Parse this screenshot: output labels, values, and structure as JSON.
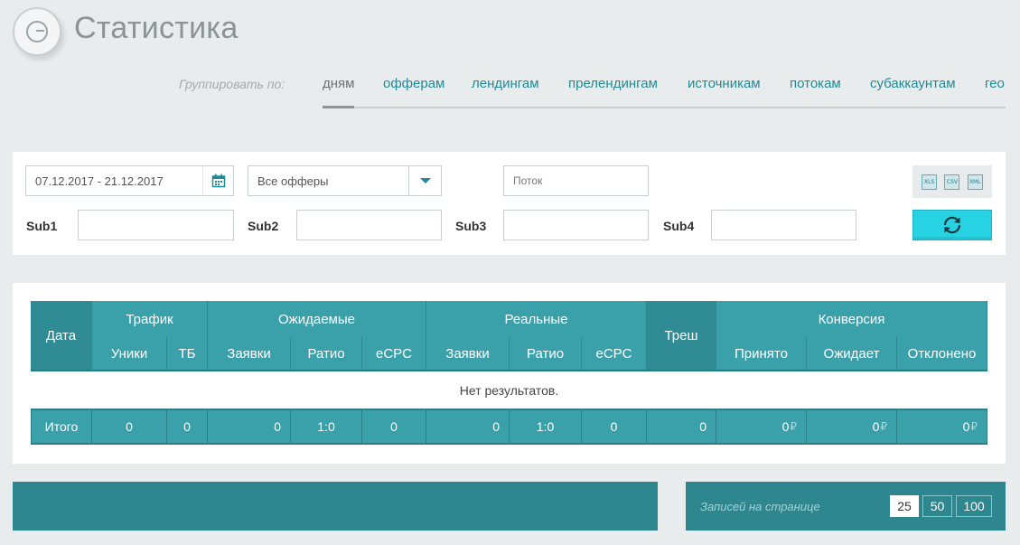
{
  "header": {
    "title": "Статистика"
  },
  "grouping": {
    "label": "Группировать по:",
    "tabs": [
      "дням",
      "офферам",
      "лендингам",
      "прелендингам",
      "источникам",
      "потокам",
      "субаккаунтам",
      "гео"
    ],
    "active": "дням"
  },
  "filters": {
    "date_range": "07.12.2017 - 21.12.2017",
    "offer_select": "Все офферы",
    "stream_placeholder": "Поток",
    "sub_labels": [
      "Sub1",
      "Sub2",
      "Sub3",
      "Sub4"
    ],
    "export_formats": [
      "XLS",
      "CSV",
      "XML"
    ]
  },
  "table": {
    "group_headers": [
      "Дата",
      "Трафик",
      "Ожидаемые",
      "Реальные",
      "Треш",
      "Конверсия"
    ],
    "sub_headers": [
      "Уники",
      "ТБ",
      "Заявки",
      "Ратио",
      "eCPC",
      "Заявки",
      "Ратио",
      "eCPC",
      "Принято",
      "Ожидает",
      "Отклонено"
    ],
    "empty_message": "Нет результатов.",
    "totals": {
      "label": "Итого",
      "values": [
        "0",
        "0",
        "0",
        "1:0",
        "0",
        "0",
        "1:0",
        "0",
        "0",
        "0",
        "0",
        "0"
      ],
      "currency_symbol": "₽"
    }
  },
  "pagination": {
    "label": "Записей на странице",
    "options": [
      "25",
      "50",
      "100"
    ],
    "selected": "25"
  },
  "colors": {
    "accent": "#3aa1aa",
    "link": "#1f8a96",
    "refresh": "#27d2e3",
    "footer": "#2e878f"
  }
}
